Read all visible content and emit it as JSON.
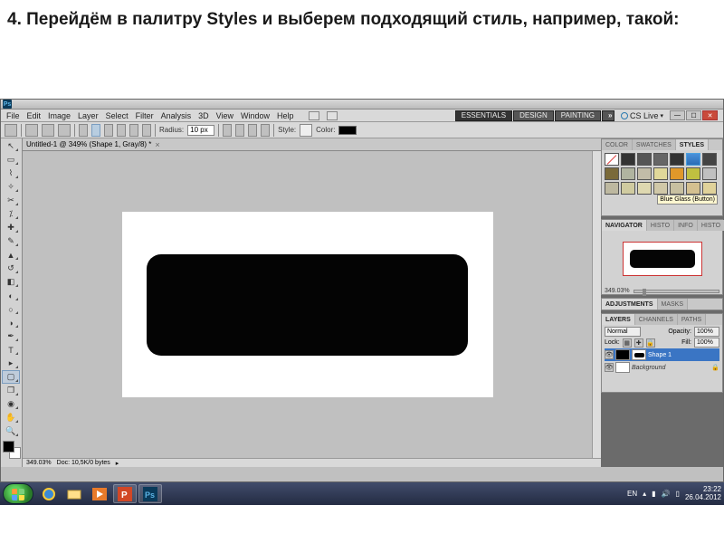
{
  "instruction": "4. Перейдём в палитру Styles и выберем подходящий стиль, например, такой:",
  "menus": {
    "file": "File",
    "edit": "Edit",
    "image": "Image",
    "layer": "Layer",
    "select": "Select",
    "filter": "Filter",
    "analysis": "Analysis",
    "three_d": "3D",
    "view": "View",
    "window": "Window",
    "help": "Help"
  },
  "workspace_switcher": {
    "essentials": "ESSENTIALS",
    "design": "DESIGN",
    "painting": "PAINTING"
  },
  "cslive": "CS Live",
  "options_bar": {
    "radius_label": "Radius:",
    "radius_value": "10 px",
    "style_label": "Style:",
    "color_label": "Color:"
  },
  "document": {
    "tab": "Untitled-1 @ 349% (Shape 1, Gray/8) *",
    "zoom": "349.03%",
    "docinfo": "Doc: 10,5K/0 bytes"
  },
  "panels": {
    "color": "COLOR",
    "swatches": "SWATCHES",
    "styles": "STYLES",
    "navigator": "NAVIGATOR",
    "histo": "HISTO",
    "info": "INFO",
    "histo2": "HISTO",
    "adjustments": "ADJUSTMENTS",
    "masks": "MASKS",
    "layers": "LAYERS",
    "channels": "CHANNELS",
    "paths": "PATHS"
  },
  "style_tooltip": "Blue Glass (Button)",
  "nav_zoom": "349.03%",
  "layers_panel": {
    "blend": "Normal",
    "opacity_lbl": "Opacity:",
    "opacity": "100%",
    "lock_lbl": "Lock:",
    "fill_lbl": "Fill:",
    "fill": "100%",
    "shape1": "Shape 1",
    "background": "Background"
  },
  "taskbar": {
    "lang": "EN",
    "time": "23:22",
    "date": "26.04.2012"
  }
}
